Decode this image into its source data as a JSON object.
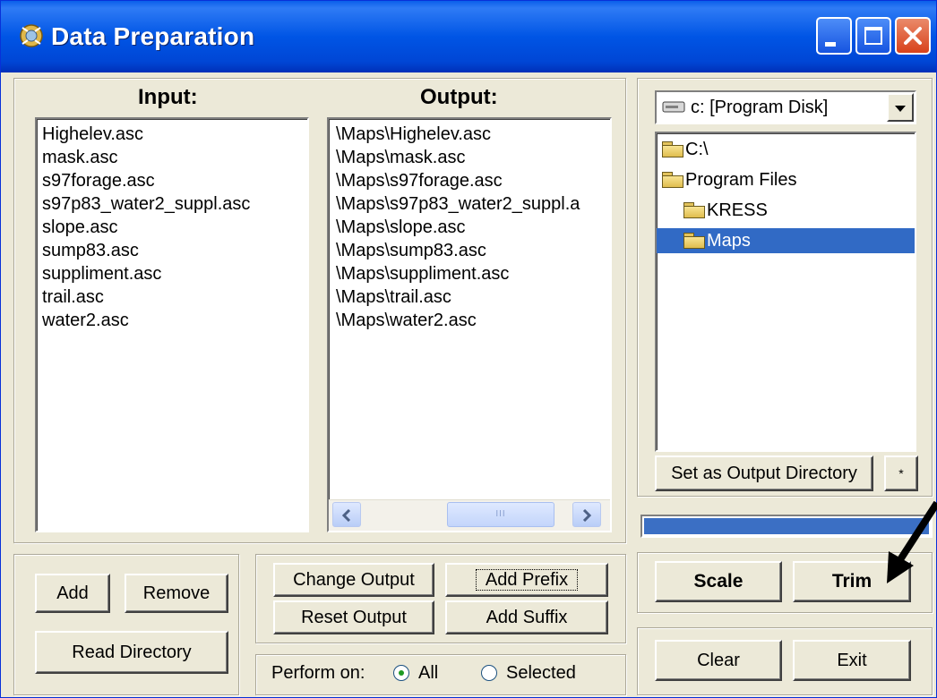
{
  "window": {
    "title": "Data Preparation",
    "controls": [
      "minimize-icon",
      "maximize-icon",
      "close-icon"
    ]
  },
  "input": {
    "header": "Input:",
    "items": [
      "Highelev.asc",
      "mask.asc",
      "s97forage.asc",
      "s97p83_water2_suppl.asc",
      "slope.asc",
      "sump83.asc",
      "suppliment.asc",
      "trail.asc",
      "water2.asc"
    ]
  },
  "output": {
    "header": "Output:",
    "items": [
      "\\Maps\\Highelev.asc",
      "\\Maps\\mask.asc",
      "\\Maps\\s97forage.asc",
      "\\Maps\\s97p83_water2_suppl.a",
      "\\Maps\\slope.asc",
      "\\Maps\\sump83.asc",
      "\\Maps\\suppliment.asc",
      "\\Maps\\trail.asc",
      "\\Maps\\water2.asc"
    ],
    "scroll_thumb_glyph": "III"
  },
  "drive": {
    "selected": "c: [Program Disk]"
  },
  "tree": {
    "nodes": [
      "C:\\",
      "Program Files",
      "KRESS",
      "Maps"
    ],
    "selected": "Maps"
  },
  "buttons": {
    "set_output_dir": "Set as Output Directory",
    "small": "*",
    "add": "Add",
    "remove": "Remove",
    "read_directory": "Read Directory",
    "change_output": "Change Output",
    "add_prefix": "Add Prefix",
    "reset_output": "Reset Output",
    "add_suffix": "Add Suffix",
    "scale": "Scale",
    "trim": "Trim",
    "clear": "Clear",
    "exit": "Exit"
  },
  "perform_on": {
    "label": "Perform on:",
    "options": [
      "All",
      "Selected"
    ],
    "selected": "All"
  },
  "progress": {
    "fraction": 1.0
  },
  "colors": {
    "titlebar": "#0055e5",
    "selection": "#316ac5",
    "progress": "#3b6fc4",
    "face": "#ece9d8"
  }
}
